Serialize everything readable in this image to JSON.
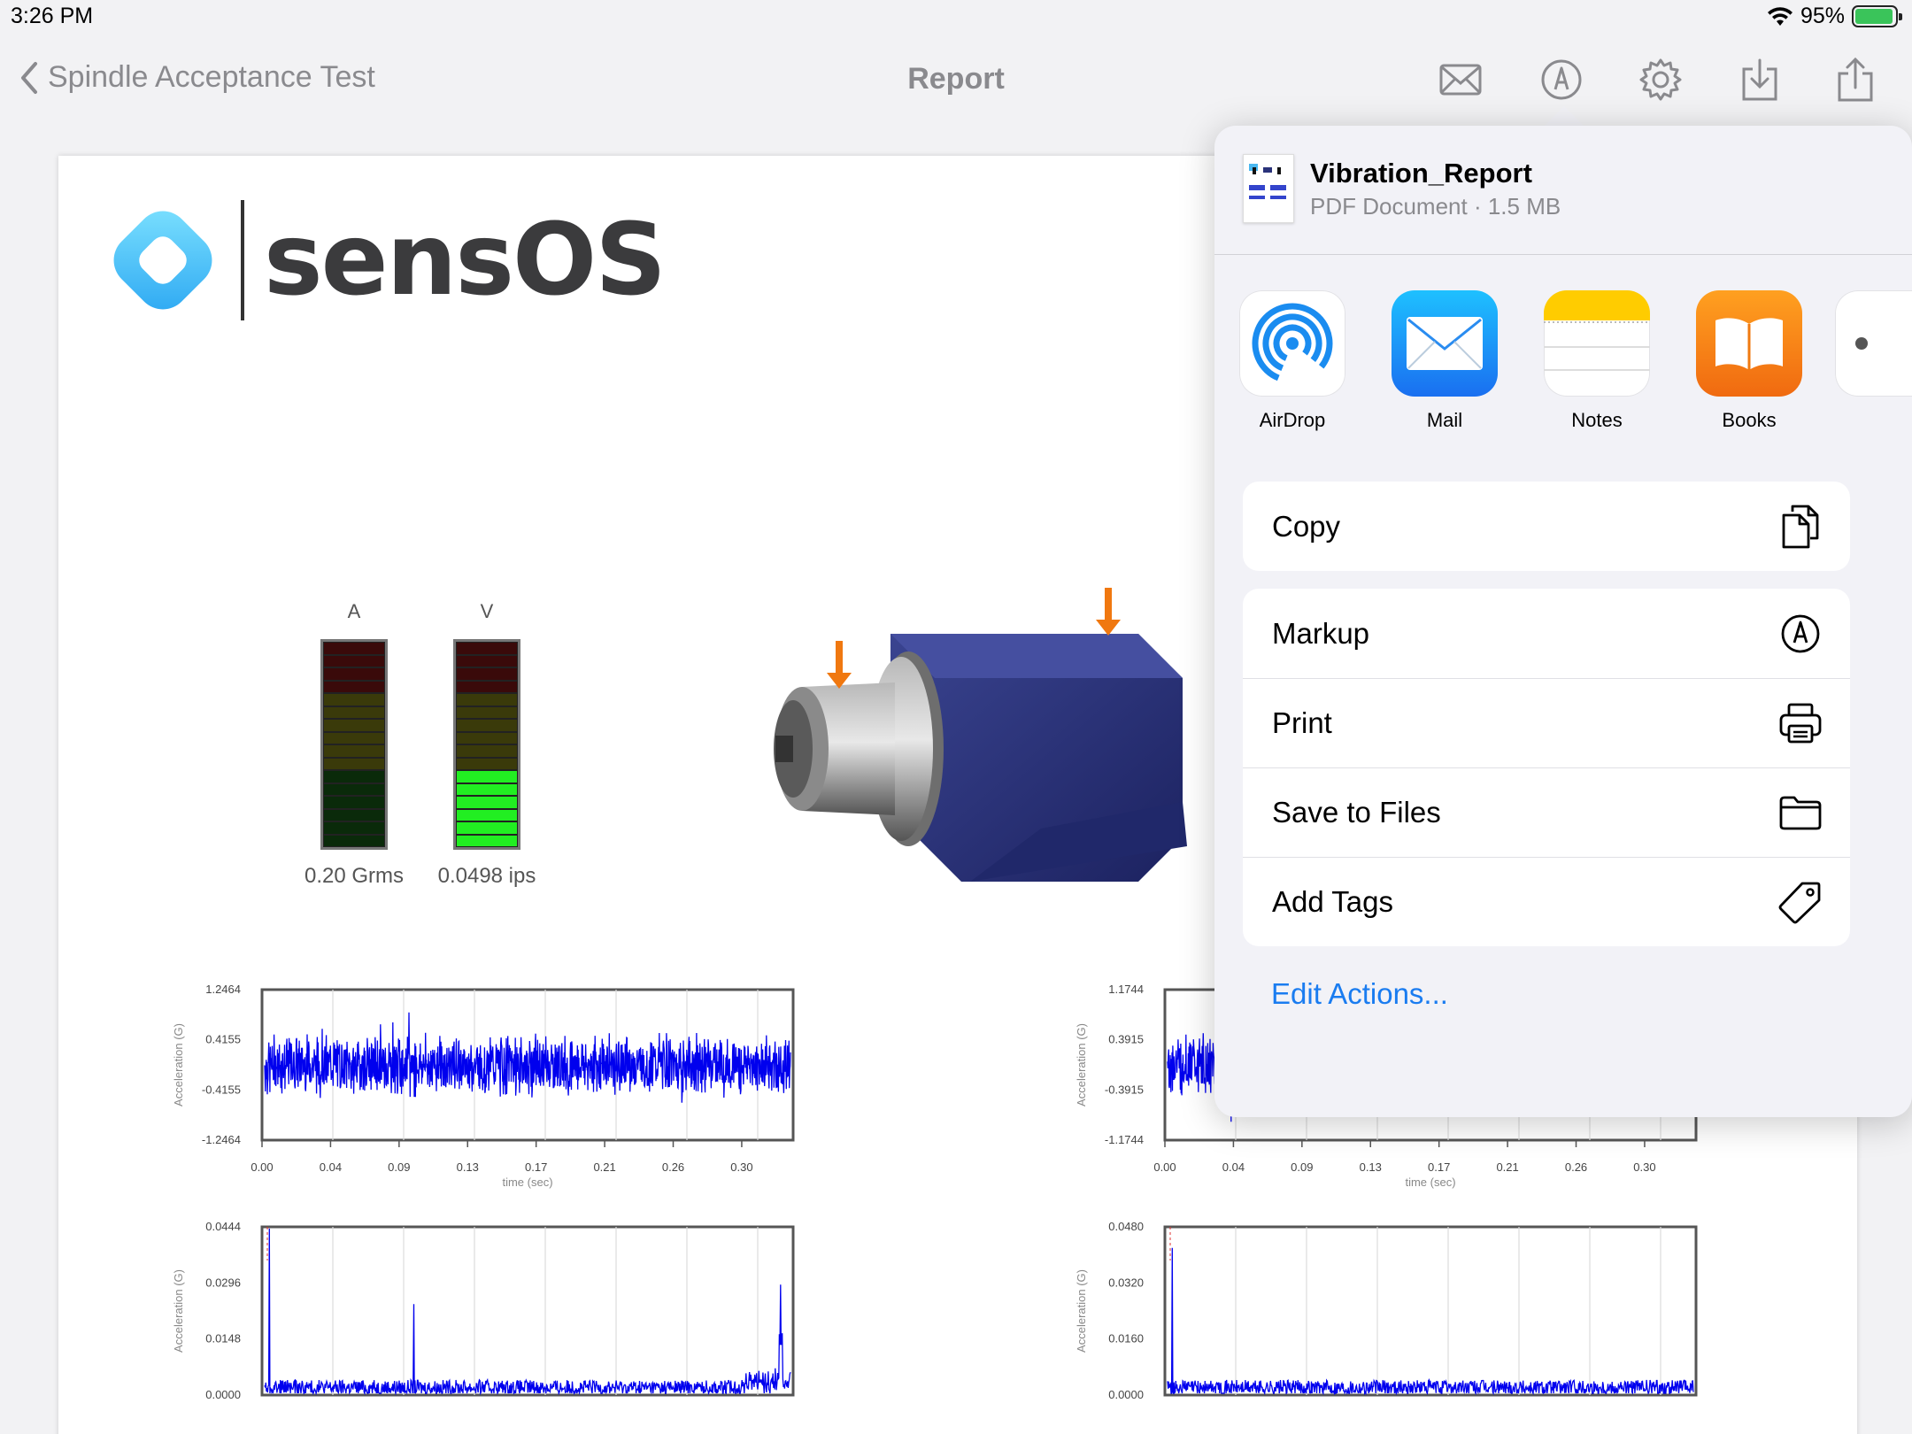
{
  "status_bar": {
    "time": "3:26 PM",
    "battery": "95%",
    "battery_level": 0.95
  },
  "nav": {
    "back_label": "Spindle Acceptance Test",
    "title": "Report",
    "icons": [
      "mail-icon",
      "markup-icon",
      "gear-icon",
      "download-icon",
      "share-icon"
    ]
  },
  "report": {
    "logo_text": "sensOS",
    "meters": [
      {
        "label": "A",
        "value_text": "0.20 Grms",
        "lit_segments": 0
      },
      {
        "label": "V",
        "value_text": "0.0498 ips",
        "lit_segments": 6
      }
    ],
    "colors": {
      "meter_red": "#3a0a0a",
      "meter_olive": "#3a3a0a",
      "meter_dark_green": "#0a2a0a",
      "meter_green": "#22ee22",
      "meter_yellow": "#ffff22",
      "signal": "#0000ee",
      "motor_housing": "#2a327a",
      "arrow": "#f07810"
    }
  },
  "chart_data": [
    {
      "type": "line",
      "title": "",
      "xlabel": "time (sec)",
      "ylabel": "Acceleration (G)",
      "y_ticks": [
        "1.2464",
        "0.4155",
        "-0.4155",
        "-1.2464"
      ],
      "x_ticks": [
        "0.00",
        "0.04",
        "0.09",
        "0.13",
        "0.17",
        "0.21",
        "0.26",
        "0.30"
      ],
      "ylim": [
        -1.2464,
        1.2464
      ],
      "xlim": [
        0,
        0.3
      ],
      "series": [
        {
          "approx_amplitude": 0.4
        }
      ]
    },
    {
      "type": "line",
      "title": "",
      "xlabel": "time (sec)",
      "ylabel": "Acceleration (G)",
      "y_ticks": [
        "1.1744",
        "0.3915",
        "-0.3915",
        "-1.1744"
      ],
      "x_ticks": [
        "0.00",
        "0.04",
        "0.09",
        "0.13",
        "0.17",
        "0.21",
        "0.26",
        "0.30"
      ],
      "ylim": [
        -1.1744,
        1.1744
      ],
      "xlim": [
        0,
        0.3
      ],
      "series": [
        {
          "approx_amplitude": 0.4
        }
      ]
    },
    {
      "type": "line",
      "title": "",
      "ylabel": "Acceleration (G)",
      "y_ticks": [
        "0.0444",
        "0.0296",
        "0.0148",
        "0.0000"
      ],
      "ylim": [
        0,
        0.0444
      ],
      "series": [
        {
          "peaks": [
            0.0444,
            0.024,
            0.026
          ]
        }
      ]
    },
    {
      "type": "line",
      "title": "",
      "ylabel": "Acceleration (G)",
      "y_ticks": [
        "0.0480",
        "0.0320",
        "0.0160",
        "0.0000"
      ],
      "ylim": [
        0,
        0.048
      ],
      "series": [
        {
          "peaks": [
            0.042
          ]
        }
      ]
    }
  ],
  "share_sheet": {
    "file_name": "Vibration_Report",
    "file_meta": "PDF Document · 1.5 MB",
    "apps": [
      {
        "label": "AirDrop",
        "icon": "airdrop-icon",
        "color": "#1a8cf0"
      },
      {
        "label": "Mail",
        "icon": "mail-app-icon",
        "color": "#1a8cf0"
      },
      {
        "label": "Notes",
        "icon": "notes-app-icon",
        "color": "#ffcc00"
      },
      {
        "label": "Books",
        "icon": "books-app-icon",
        "color": "#f07a10"
      }
    ],
    "actions_primary": [
      {
        "label": "Copy",
        "icon": "copy-icon"
      }
    ],
    "actions_secondary": [
      {
        "label": "Markup",
        "icon": "markup-icon"
      },
      {
        "label": "Print",
        "icon": "printer-icon"
      },
      {
        "label": "Save to Files",
        "icon": "folder-icon"
      },
      {
        "label": "Add Tags",
        "icon": "tag-icon"
      }
    ],
    "edit_actions": "Edit Actions..."
  }
}
